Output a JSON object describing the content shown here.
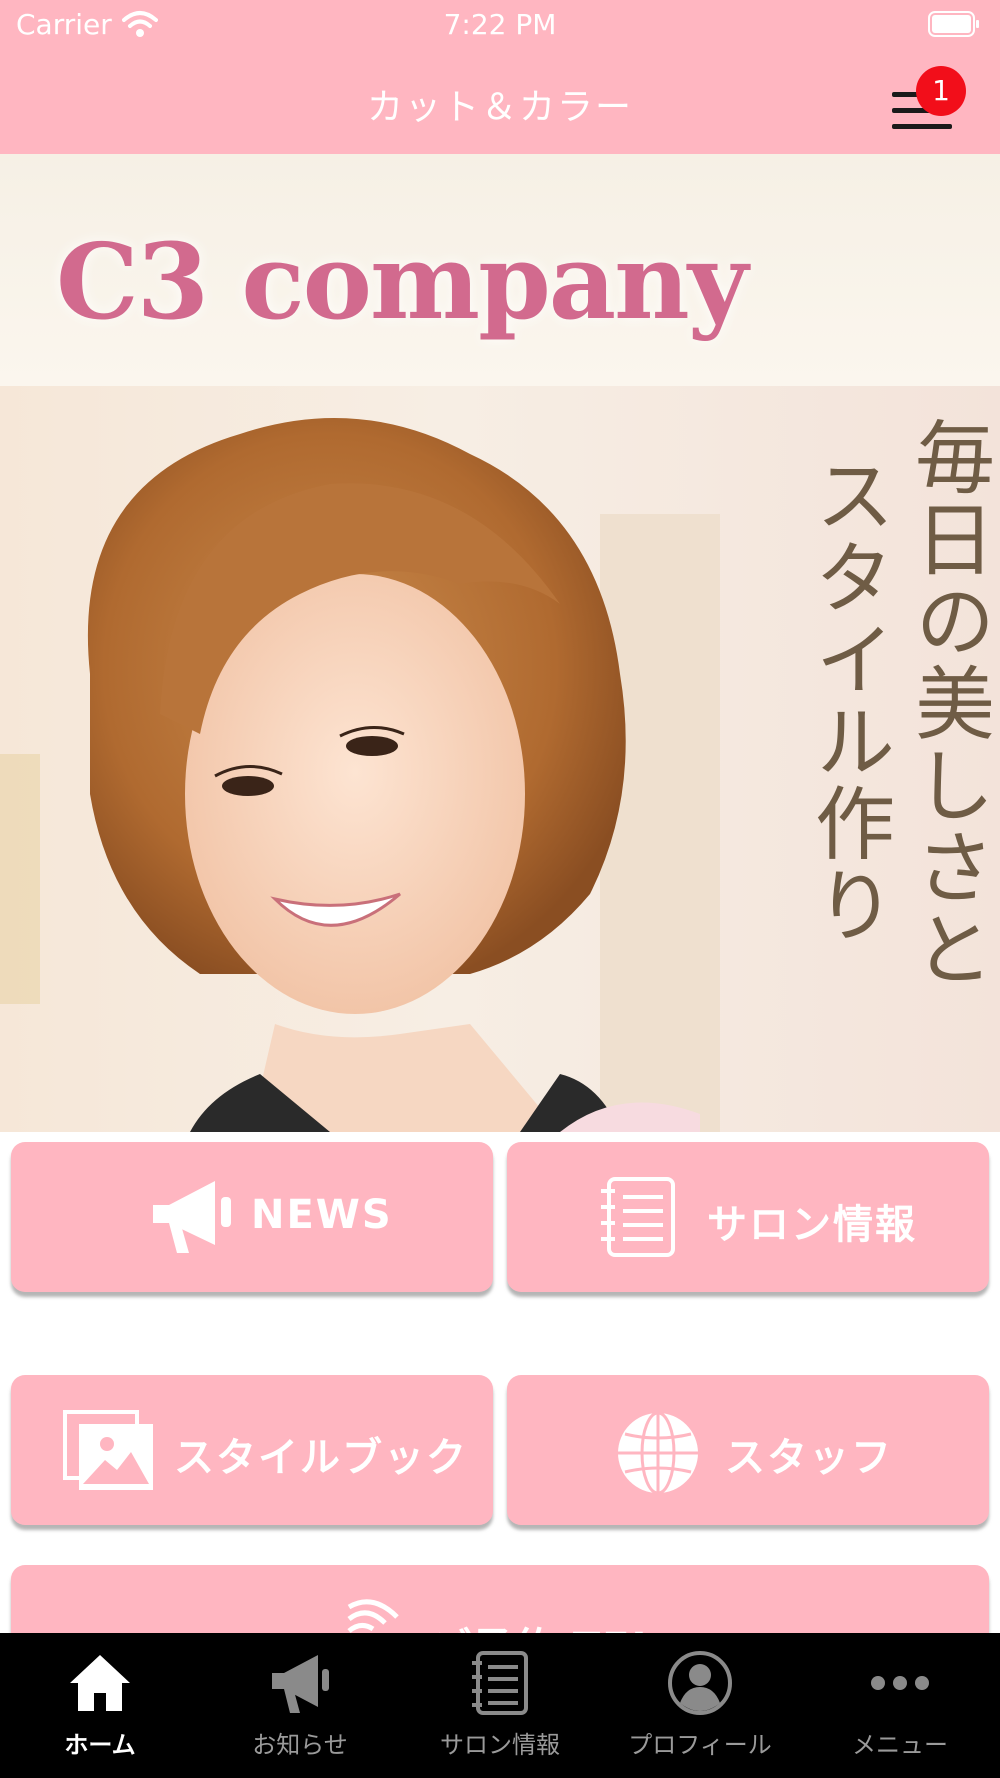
{
  "status_bar": {
    "carrier": "Carrier",
    "time": "7:22 PM"
  },
  "header": {
    "title": "カット＆カラー",
    "badge_count": "1"
  },
  "hero": {
    "brand": "C3 company",
    "tagline_line1": "毎日の美しさと",
    "tagline_line2": "スタイル作り"
  },
  "grid_buttons": [
    {
      "label": "NEWS",
      "icon": "megaphone-icon"
    },
    {
      "label": "サロン情報",
      "icon": "notebook-icon"
    },
    {
      "label": "スタイルブック",
      "icon": "photos-icon"
    },
    {
      "label": "スタッフ",
      "icon": "globe-icon"
    },
    {
      "label": "ご予約 TEL",
      "icon": "phone-signal-icon"
    }
  ],
  "tab_bar": [
    {
      "label": "ホーム",
      "icon": "home-icon",
      "active": true
    },
    {
      "label": "お知らせ",
      "icon": "megaphone-icon",
      "active": false
    },
    {
      "label": "サロン情報",
      "icon": "notebook-icon",
      "active": false
    },
    {
      "label": "プロフィール",
      "icon": "profile-icon",
      "active": false
    },
    {
      "label": "メニュー",
      "icon": "more-icon",
      "active": false
    }
  ],
  "colors": {
    "accent_pink": "#ffb6c1",
    "badge_red": "#f20e1a",
    "brand_pink": "#d26a8e"
  }
}
